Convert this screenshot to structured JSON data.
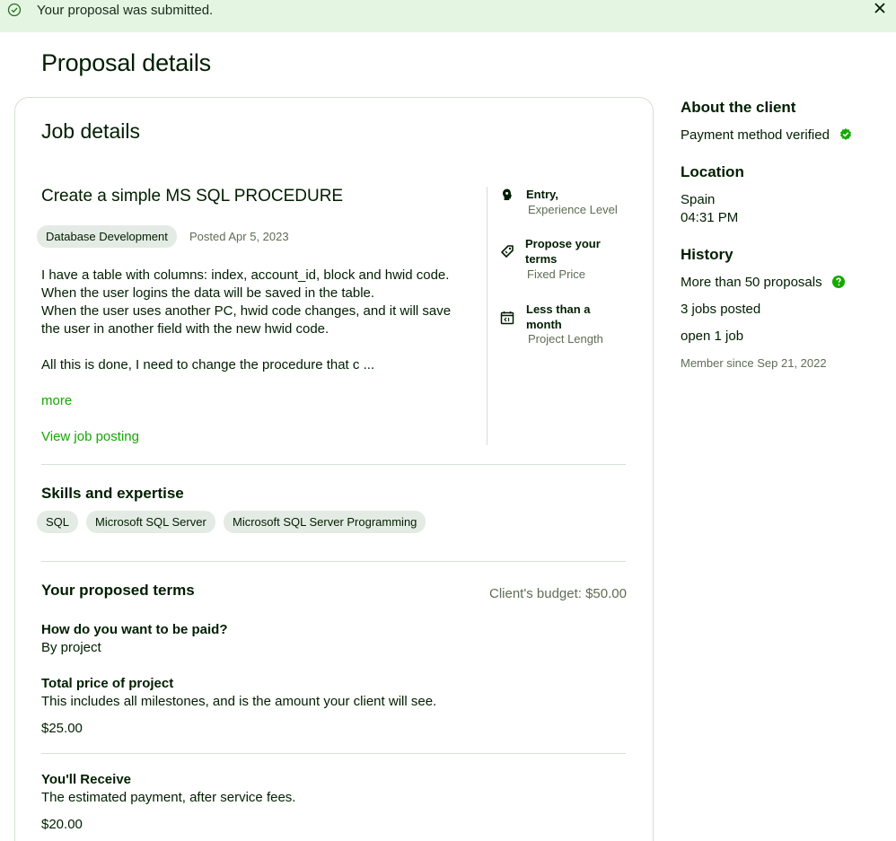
{
  "banner": {
    "message": "Your proposal was submitted.",
    "success_icon": "check-circle-icon",
    "close_icon": "close-icon",
    "background": "#e4f6e2"
  },
  "page": {
    "title": "Proposal details"
  },
  "job": {
    "section_title": "Job details",
    "title": "Create a simple MS SQL PROCEDURE",
    "category": "Database Development",
    "posted": "Posted Apr 5, 2023",
    "description_p1": "I have a table with columns: index, account_id, block and hwid code.\nWhen the user logins the data will be saved in the table.\nWhen the user uses another PC, hwid code changes, and it will save the user in another field with the new hwid code.",
    "description_p2": "All this is done, I need to change the procedure that c ...",
    "more_link": "more",
    "view_link": "View job posting",
    "attributes": [
      {
        "icon": "experience-level-icon",
        "value": "Entry,",
        "label": "Experience Level"
      },
      {
        "icon": "price-tag-icon",
        "value": "Propose your terms",
        "label": "Fixed Price"
      },
      {
        "icon": "calendar-icon",
        "value": "Less than a month",
        "label": "Project Length"
      }
    ]
  },
  "skills": {
    "title": "Skills and expertise",
    "items": [
      "SQL",
      "Microsoft SQL Server",
      "Microsoft SQL Server Programming"
    ]
  },
  "terms": {
    "title": "Your proposed terms",
    "budget": "Client's budget: $50.00",
    "paid_q": "How do you want to be paid?",
    "paid_a": "By project",
    "total_label": "Total price of project",
    "total_desc": "This includes all milestones, and is the amount your client will see.",
    "total_value": "$25.00",
    "receive_label": "You'll Receive",
    "receive_desc": "The estimated payment, after service fees.",
    "receive_value": "$20.00"
  },
  "client": {
    "about_title": "About the client",
    "payment": "Payment method verified",
    "verified_icon": "verified-badge-icon",
    "location_title": "Location",
    "country": "Spain",
    "local_time": "04:31 PM",
    "history_title": "History",
    "proposals": "More than 50 proposals",
    "help_icon": "help-icon",
    "jobs_posted": "3 jobs posted",
    "open_jobs": "open 1 job",
    "member_since": "Member since Sep 21, 2022"
  },
  "colors": {
    "accent": "#14a800",
    "text": "#001e00",
    "muted": "#5e6d55",
    "border": "#d5e0d5"
  }
}
